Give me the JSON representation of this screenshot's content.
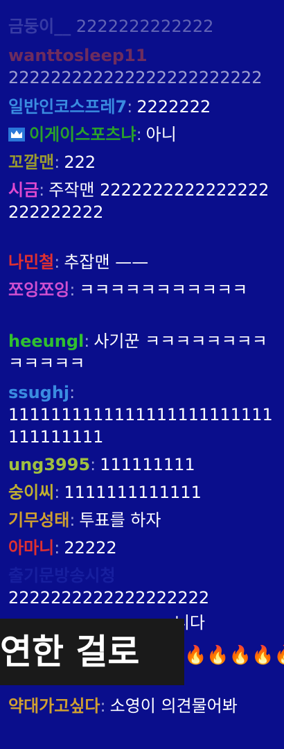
{
  "chat": {
    "messages": [
      {
        "nick": "금둥이__",
        "text": "2222222222222",
        "nick_color": "#8c90d4",
        "faded": true
      },
      {
        "nick": "wanttosleep11",
        "text": "222222222222222222222222",
        "nick_color": "#b04040",
        "faded": true
      },
      {
        "nick": "일반인코스프레7",
        "text": "2222222",
        "nick_color": "#3a8ce0"
      },
      {
        "nick": "이게이스포츠냐",
        "text": "아니",
        "nick_color": "#2aa12a",
        "badge": "crown-icon"
      },
      {
        "nick": "꼬깔맨",
        "text": "222",
        "nick_color": "#9a9a30"
      },
      {
        "nick": "시금",
        "text": "주작맨 2222222222222222222222222",
        "nick_color": "#e04ad0"
      },
      {
        "nick": "나민철",
        "text": "추잡맨 ——",
        "nick_color": "#e03030"
      },
      {
        "nick": "쪼잉쪼잉",
        "text": "ㅋㅋㅋㅋㅋㅋㅋㅋㅋㅋㅋ",
        "nick_color": "#d050d0"
      },
      {
        "nick": "heeungl",
        "text": "사기꾼 ㅋㅋㅋㅋㅋㅋㅋㅋㅋㅋㅋㅋㅋ",
        "nick_color": "#30c030"
      },
      {
        "nick": "ssughj",
        "text": "1111111111111111111111111111111111",
        "nick_color": "#3a8ce0"
      },
      {
        "nick": "ung3995",
        "text": "111111111",
        "nick_color": "#a0c040"
      },
      {
        "nick": "숭이씨",
        "text": "1111111111111",
        "nick_color": "#c0b030"
      },
      {
        "nick": "기무성태",
        "text": "투표를 하자",
        "nick_color": "#d0a030"
      },
      {
        "nick": "아마니",
        "text": "22222",
        "nick_color": "#e03030"
      },
      {
        "nick": "출기문방송시청",
        "text": "2222222222222222222",
        "nick_color": "#3040c0",
        "faded": true
      },
      {
        "nick": "약대가고싶다",
        "text": "소영이 의견물어봐",
        "nick_color": "#d0a030"
      }
    ]
  },
  "overlay": {
    "caption": "연한 걸로",
    "partial_line": "니다",
    "fire": "🔥🔥🔥🔥🔥"
  }
}
